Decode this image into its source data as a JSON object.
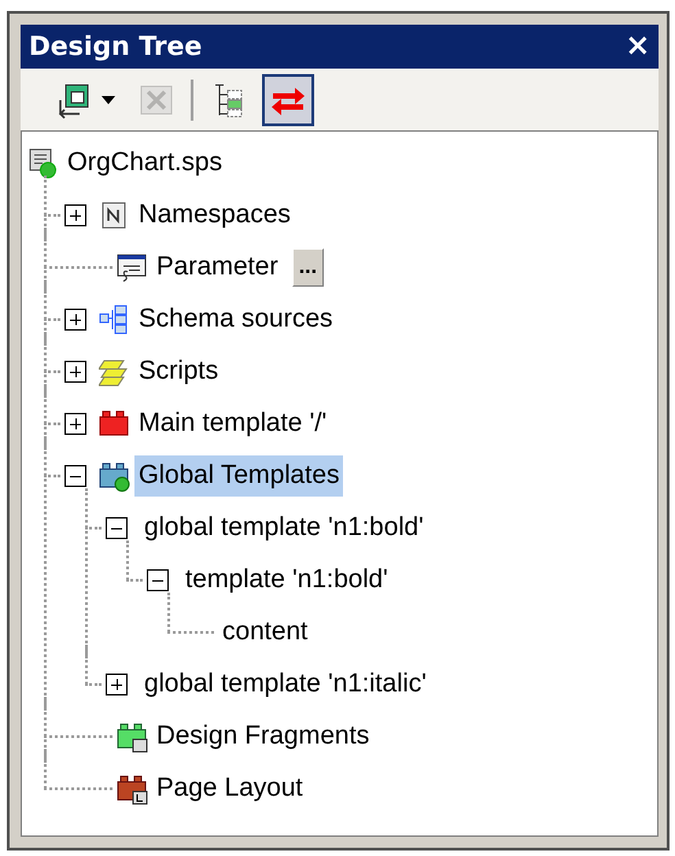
{
  "window": {
    "title": "Design Tree",
    "close": "×"
  },
  "toolbar": [
    {
      "kind": "add",
      "has_menu": true,
      "disabled": false,
      "pressed": false
    },
    {
      "kind": "remove",
      "has_menu": false,
      "disabled": true,
      "pressed": false
    },
    {
      "kind": "separator"
    },
    {
      "kind": "tree",
      "has_menu": false,
      "disabled": false,
      "pressed": false
    },
    {
      "kind": "sync",
      "has_menu": false,
      "disabled": false,
      "pressed": true
    }
  ],
  "tree": {
    "label": "OrgChart.sps",
    "kind": "document",
    "selected": false,
    "children": [
      {
        "label": "Namespaces",
        "kind": "namespace",
        "expanded": false,
        "selected": false
      },
      {
        "label": "Parameter",
        "kind": "parameter",
        "selected": false,
        "button": "..."
      },
      {
        "label": "Schema sources",
        "kind": "schema",
        "expanded": false,
        "selected": false
      },
      {
        "label": "Scripts",
        "kind": "scripts",
        "expanded": false,
        "selected": false
      },
      {
        "label": "Main template '/'",
        "kind": "main-template",
        "expanded": false,
        "selected": false
      },
      {
        "label": "Global Templates",
        "kind": "global-templates",
        "expanded": true,
        "selected": true,
        "children": [
          {
            "label": "global template 'n1:bold'",
            "expanded": true,
            "selected": false,
            "children": [
              {
                "label": "template 'n1:bold'",
                "expanded": true,
                "selected": false,
                "children": [
                  {
                    "label": "content",
                    "selected": false
                  }
                ]
              }
            ]
          },
          {
            "label": "global template 'n1:italic'",
            "expanded": false,
            "selected": false
          }
        ]
      },
      {
        "label": "Design Fragments",
        "kind": "fragments",
        "selected": false
      },
      {
        "label": "Page Layout",
        "kind": "page-layout",
        "selected": false
      }
    ]
  }
}
